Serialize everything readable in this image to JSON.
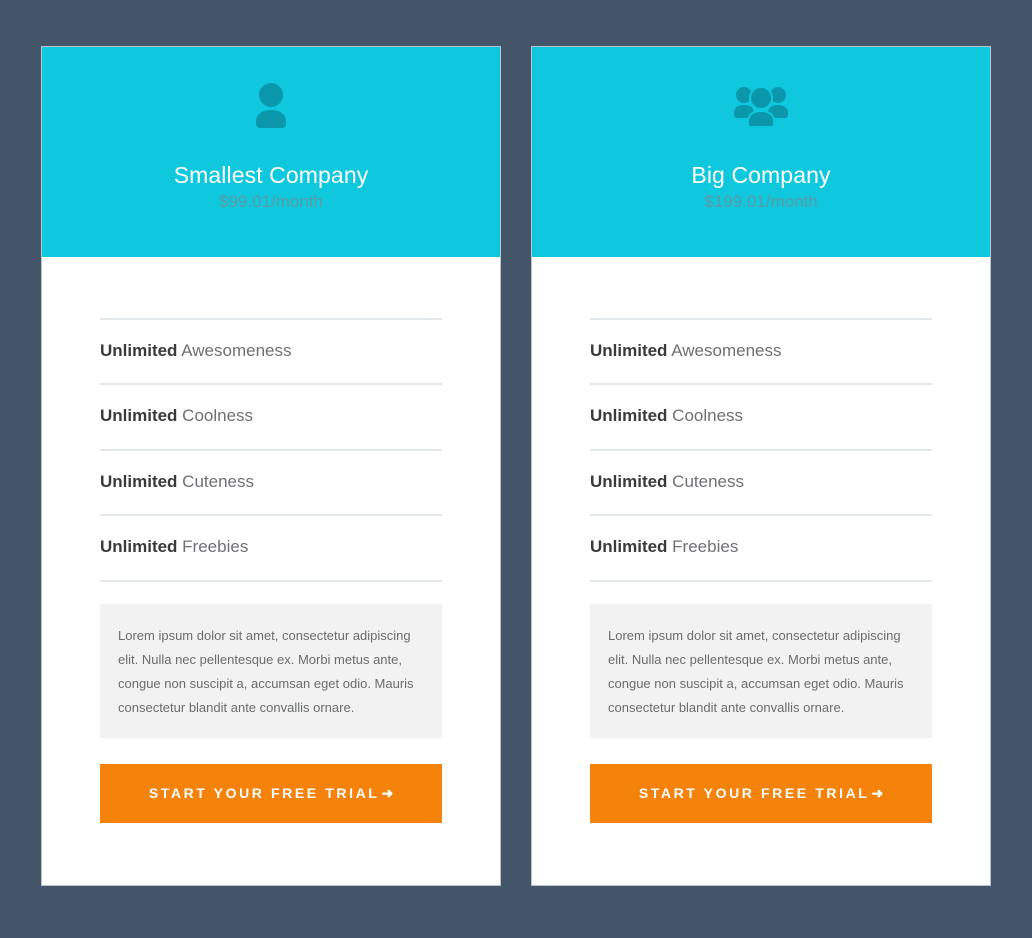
{
  "theme": {
    "page_background": "#44556a",
    "header_accent": "#0fc8de",
    "icon_color": "#0a97ab",
    "cta_color": "#f5820a",
    "divider_color": "#e3e8ea",
    "blurb_background": "#f2f2f2"
  },
  "cards": [
    {
      "icon": "single-user-icon",
      "plan_name": "Smallest Company",
      "price": "$99.01/month",
      "features": [
        {
          "qty": "Unlimited",
          "label": " Awesomeness"
        },
        {
          "qty": "Unlimited",
          "label": " Coolness"
        },
        {
          "qty": "Unlimited",
          "label": " Cuteness"
        },
        {
          "qty": "Unlimited",
          "label": " Freebies"
        }
      ],
      "blurb": "Lorem ipsum dolor sit amet, consectetur adipiscing elit. Nulla nec pellentesque ex. Morbi metus ante, congue non suscipit a, accumsan eget odio. Mauris consectetur blandit ante convallis ornare.",
      "cta_label": "Start Your Free Trial",
      "cta_arrow": "➜"
    },
    {
      "icon": "group-users-icon",
      "plan_name": "Big Company",
      "price": "$199.01/month",
      "features": [
        {
          "qty": "Unlimited",
          "label": " Awesomeness"
        },
        {
          "qty": "Unlimited",
          "label": " Coolness"
        },
        {
          "qty": "Unlimited",
          "label": " Cuteness"
        },
        {
          "qty": "Unlimited",
          "label": " Freebies"
        }
      ],
      "blurb": "Lorem ipsum dolor sit amet, consectetur adipiscing elit. Nulla nec pellentesque ex. Morbi metus ante, congue non suscipit a, accumsan eget odio. Mauris consectetur blandit ante convallis ornare.",
      "cta_label": "Start Your Free Trial",
      "cta_arrow": "➜"
    }
  ]
}
